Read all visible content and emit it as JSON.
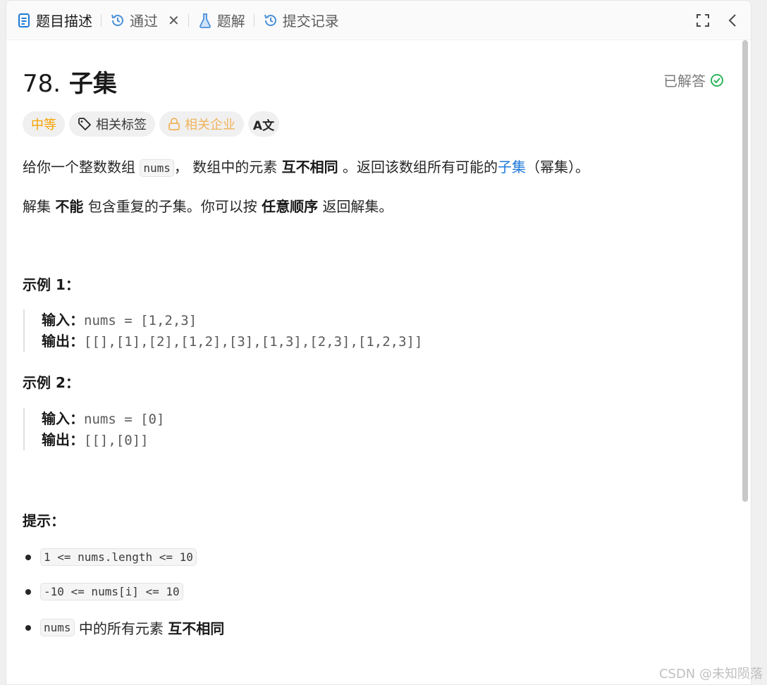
{
  "tabs": {
    "description": "题目描述",
    "passed": "通过",
    "solution": "题解",
    "submissions": "提交记录"
  },
  "problem": {
    "number": "78.",
    "title": "子集",
    "status": "已解答"
  },
  "tags": {
    "difficulty": "中等",
    "related_tags": "相关标签",
    "related_companies": "相关企业",
    "translate": "A文"
  },
  "description": {
    "p1_a": "给你一个整数数组",
    "p1_code": "nums",
    "p1_b": "， 数组中的元素",
    "p1_bold": "互不相同",
    "p1_c": "。返回该数组所有可能的",
    "p1_link": "子集",
    "p1_d": "（幂集）。",
    "p2_a": "解集",
    "p2_bold1": "不能",
    "p2_b": "包含重复的子集。你可以按",
    "p2_bold2": "任意顺序",
    "p2_c": "返回解集。"
  },
  "examples": [
    {
      "heading": "示例 1：",
      "input_label": "输入：",
      "input": "nums = [1,2,3]",
      "output_label": "输出：",
      "output": "[[],[1],[2],[1,2],[3],[1,3],[2,3],[1,2,3]]"
    },
    {
      "heading": "示例 2：",
      "input_label": "输入：",
      "input": "nums = [0]",
      "output_label": "输出：",
      "output": "[[],[0]]"
    }
  ],
  "constraints": {
    "heading": "提示：",
    "items": [
      "1 <= nums.length <= 10",
      "-10 <= nums[i] <= 10"
    ],
    "item3_code": "nums",
    "item3_text": "中的所有元素",
    "item3_bold": "互不相同"
  },
  "watermark": "CSDN @未知陨落",
  "colors": {
    "difficulty_medium": "#f5a300",
    "solved_green": "#2db55d",
    "link_blue": "#1f7ad9"
  }
}
